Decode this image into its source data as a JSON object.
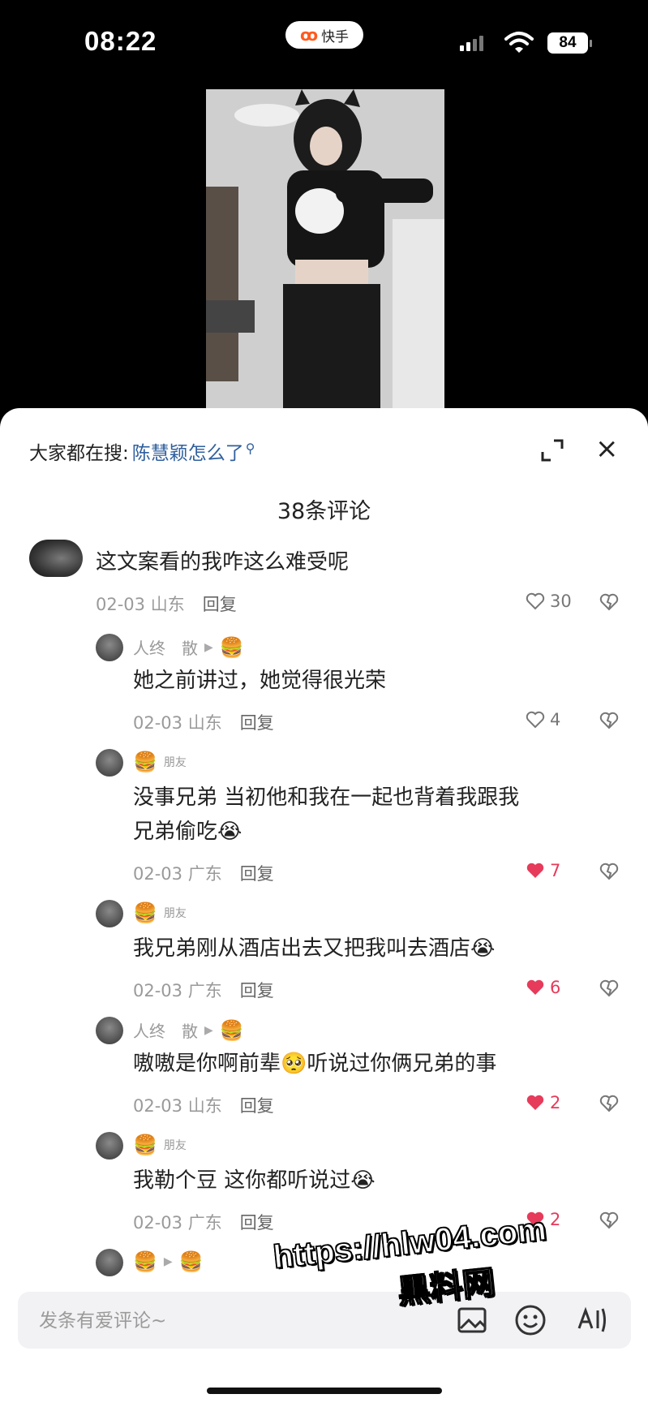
{
  "status_bar": {
    "time": "08:22",
    "app_name": "快手",
    "battery": "84"
  },
  "sheet": {
    "search_prefix": "大家都在搜:",
    "search_query": "陈慧颖怎么了",
    "comment_count": "38条评论"
  },
  "comments": [
    {
      "text": "这文案看的我咋这么难受呢",
      "date": "02-03",
      "location": "山东",
      "reply": "回复",
      "likes": "30"
    },
    {
      "name": "人终　散",
      "text": "她之前讲过，她觉得很光荣",
      "date": "02-03",
      "location": "山东",
      "reply": "回复",
      "likes": "4"
    },
    {
      "tag": "朋友",
      "text_line1": "没事兄弟 当初他和我在一起也背着我跟我",
      "text_line2": "兄弟偷吃",
      "date": "02-03",
      "location": "广东",
      "reply": "回复",
      "likes": "7"
    },
    {
      "tag": "朋友",
      "text": "我兄弟刚从酒店出去又把我叫去酒店",
      "date": "02-03",
      "location": "广东",
      "reply": "回复",
      "likes": "6"
    },
    {
      "name": "人终　散",
      "text_before": "嗷嗷是你啊前辈",
      "text_after": "听说过你俩兄弟的事",
      "date": "02-03",
      "location": "山东",
      "reply": "回复",
      "likes": "2"
    },
    {
      "tag": "朋友",
      "text": "我勒个豆 这你都听说过",
      "date": "02-03",
      "location": "广东",
      "reply": "回复",
      "likes": "2"
    }
  ],
  "input": {
    "placeholder": "发条有爱评论~"
  },
  "watermark": {
    "line1": "https://hlw04.com",
    "line2": "黑料网"
  },
  "colors": {
    "like_active": "#e63b5a",
    "search_link": "#2f5f9e",
    "brand": "#ff5a1f"
  }
}
